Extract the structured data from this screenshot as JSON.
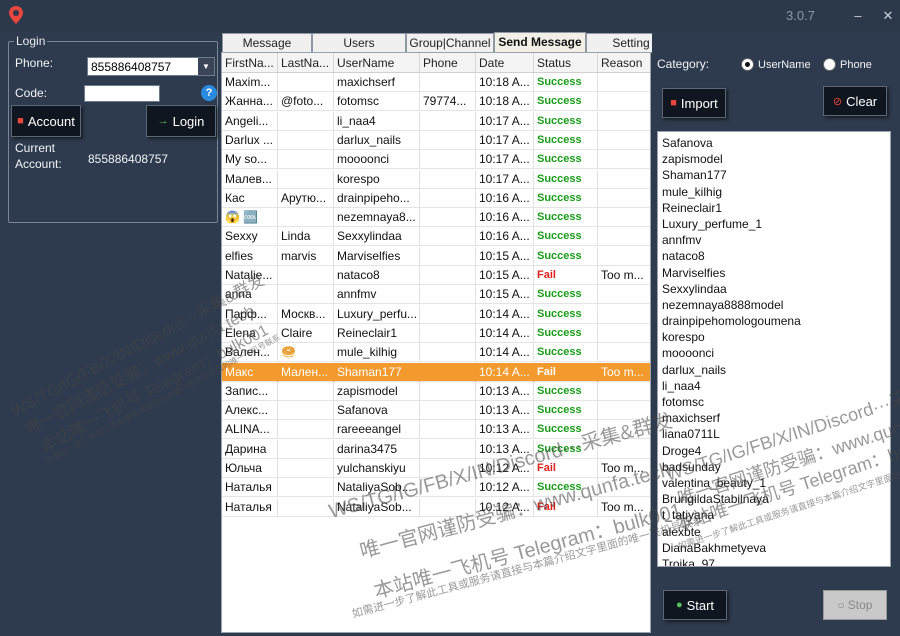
{
  "app": {
    "version": "3.0.7",
    "title": ""
  },
  "login": {
    "legend": "Login",
    "phone_label": "Phone:",
    "phone_value": "855886408757",
    "code_label": "Code:",
    "code_value": "",
    "help_symbol": "?",
    "account_button": "Account",
    "login_button": "Login",
    "current_label_1": "Current",
    "current_label_2": "Account:",
    "current_value": "855886408757"
  },
  "tabs": [
    "Message",
    "Users",
    "Group|Channel",
    "Send Message",
    "Setting"
  ],
  "active_tab": "Send Message",
  "grid": {
    "headers": [
      "FirstNa...",
      "LastNa...",
      "UserName",
      "Phone",
      "Date",
      "Status",
      "Reason"
    ],
    "rows": [
      [
        "Maxim...",
        "",
        "maxichserf",
        "",
        "10:18 A...",
        "Success",
        ""
      ],
      [
        "Жанна...",
        "@foto...",
        "fotomsc",
        "79774...",
        "10:18 A...",
        "Success",
        ""
      ],
      [
        "Angeli...",
        "",
        "li_naa4",
        "",
        "10:17 A...",
        "Success",
        ""
      ],
      [
        "Darlux ...",
        "",
        "darlux_nails",
        "",
        "10:17 A...",
        "Success",
        ""
      ],
      [
        "My so...",
        "",
        "moooonci",
        "",
        "10:17 A...",
        "Success",
        ""
      ],
      [
        "Малев...",
        "",
        "korespo",
        "",
        "10:17 A...",
        "Success",
        ""
      ],
      [
        "Кас",
        "Арутю...",
        "drainpipeho...",
        "",
        "10:16 A...",
        "Success",
        ""
      ],
      [
        "😱 🆒",
        "",
        "nezemnaya8...",
        "",
        "10:16 A...",
        "Success",
        ""
      ],
      [
        "Sexxy",
        "Linda",
        "Sexxylindaa",
        "",
        "10:16 A...",
        "Success",
        ""
      ],
      [
        "elfies",
        "marvis",
        "Marviselfies",
        "",
        "10:15 A...",
        "Success",
        ""
      ],
      [
        "Natalie...",
        "",
        "nataco8",
        "",
        "10:15 A...",
        "Fail",
        "Too m..."
      ],
      [
        "anna",
        "",
        "annfmv",
        "",
        "10:15 A...",
        "Success",
        ""
      ],
      [
        "Парф...",
        "Москв...",
        "Luxury_perfu...",
        "",
        "10:14 A...",
        "Success",
        ""
      ],
      [
        "Elena",
        "Claire",
        "Reineclair1",
        "",
        "10:14 A...",
        "Success",
        ""
      ],
      [
        "Вален...",
        "🥯",
        "mule_kilhig",
        "",
        "10:14 A...",
        "Success",
        ""
      ],
      [
        "Макс",
        "Мален...",
        "Shaman177",
        "",
        "10:14 A...",
        "Fail",
        "Too m..."
      ],
      [
        "Запис...",
        "",
        "zapismodel",
        "",
        "10:13 A...",
        "Success",
        ""
      ],
      [
        "Алекс...",
        "",
        "Safanova",
        "",
        "10:13 A...",
        "Success",
        ""
      ],
      [
        "ALINA...",
        "",
        "rareeeangel",
        "",
        "10:13 A...",
        "Success",
        ""
      ],
      [
        "Дарина",
        "",
        "darina3475",
        "",
        "10:13 A...",
        "Success",
        ""
      ],
      [
        "Юльча",
        "",
        "yulchanskiyu",
        "",
        "10:12 A...",
        "Fail",
        "Too m..."
      ],
      [
        "Наталья",
        "",
        "NataliyaSob...",
        "",
        "10:12 A...",
        "Success",
        ""
      ],
      [
        "Наталья",
        "",
        "NataliyaSob...",
        "",
        "10:12 A...",
        "Fail",
        "Too m..."
      ]
    ],
    "selected_row_index": 15
  },
  "right": {
    "category_label": "Category:",
    "radio_username": "UserName",
    "radio_phone": "Phone",
    "selected_radio": "UserName",
    "import_button": "Import",
    "clear_button": "Clear",
    "start_button": "Start",
    "stop_button": "Stop",
    "users": [
      "Safanova",
      "zapismodel",
      "Shaman177",
      "mule_kilhig",
      "Reineclair1",
      "Luxury_perfume_1",
      "annfmv",
      "nataco8",
      "Marviselfies",
      "Sexxylindaa",
      "nezemnaya8888model",
      "drainpipehomologoumena",
      "korespo",
      "moooonci",
      "darlux_nails",
      "li_naa4",
      "fotomsc",
      "maxichserf",
      "liana0711L",
      "Droge4",
      "badsunday",
      "valentina_beauty_1",
      "BrungildaStabilnaya",
      "t_tatiyana",
      "alexbte",
      "DianaBakhmetyeva",
      "Troika_97"
    ]
  },
  "watermark": {
    "line1": "WS/TG/IG/FB/X/IN/Discord···采集&群发",
    "line2": "唯一官网谨防受骗：www.qunfa.tech",
    "line3": "本站唯一飞机号 Telegram：bulk001",
    "line4": "如需进一步了解此工具或服务请直接与本篇介绍文字里面的唯一飞机号联系"
  }
}
